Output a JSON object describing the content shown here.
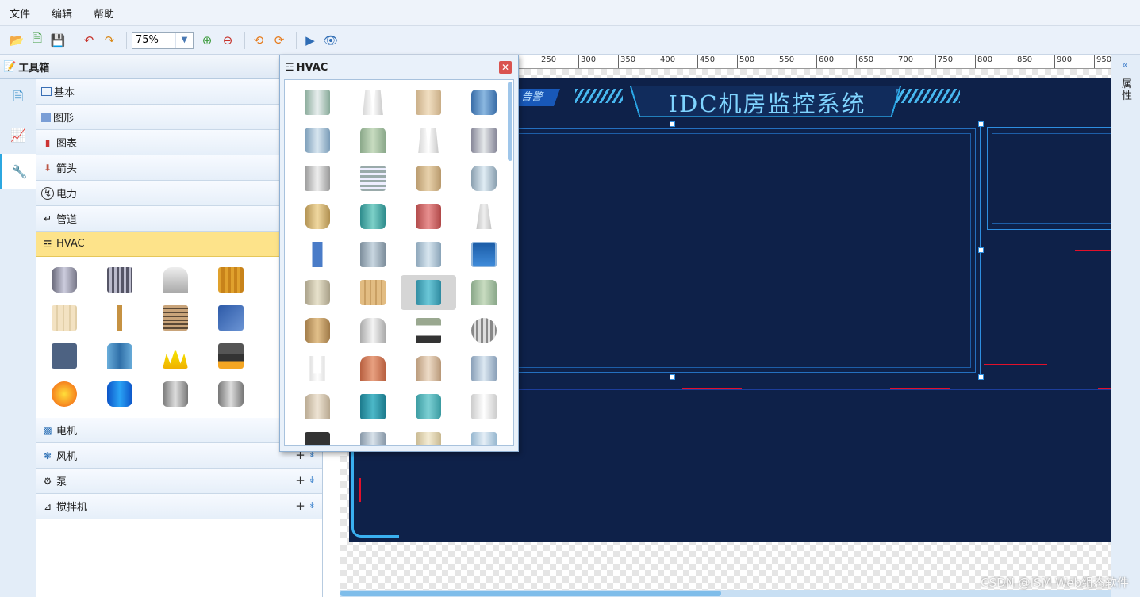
{
  "menu": [
    "文件",
    "编辑",
    "帮助"
  ],
  "toolbar": {
    "zoom_value": "75%"
  },
  "toolbox": {
    "title": "工具箱",
    "categories": [
      {
        "label": "基本",
        "icon": "rectangle-icon"
      },
      {
        "label": "图形",
        "icon": "shape-icon"
      },
      {
        "label": "图表",
        "icon": "bar-chart-icon"
      },
      {
        "label": "箭头",
        "icon": "arrow-icon"
      },
      {
        "label": "电力",
        "icon": "power-icon"
      },
      {
        "label": "管道",
        "icon": "pipe-icon"
      },
      {
        "label": "HVAC",
        "icon": "hvac-icon"
      },
      {
        "label": "电机",
        "icon": "motor-icon"
      },
      {
        "label": "风机",
        "icon": "fan-icon"
      },
      {
        "label": "泵",
        "icon": "pump-icon"
      },
      {
        "label": "搅拌机",
        "icon": "mixer-icon"
      }
    ]
  },
  "hvac_popup": {
    "title": "HVAC"
  },
  "ruler": {
    "marks": [
      "250",
      "300",
      "350",
      "400",
      "450",
      "500",
      "550",
      "600",
      "650",
      "700",
      "750",
      "800",
      "850",
      "900",
      "950"
    ]
  },
  "dashboard": {
    "title": "IDC机房监控系统",
    "alarm_label": "告警"
  },
  "right_panel": {
    "label": "属性"
  },
  "watermark": "CSDN @ISM Web组态软件",
  "colors": {
    "dashboard_bg": "#0e2149",
    "accent_blue": "#2d8ee0",
    "alarm_red": "#e2102a",
    "active_category": "#fde38a"
  }
}
